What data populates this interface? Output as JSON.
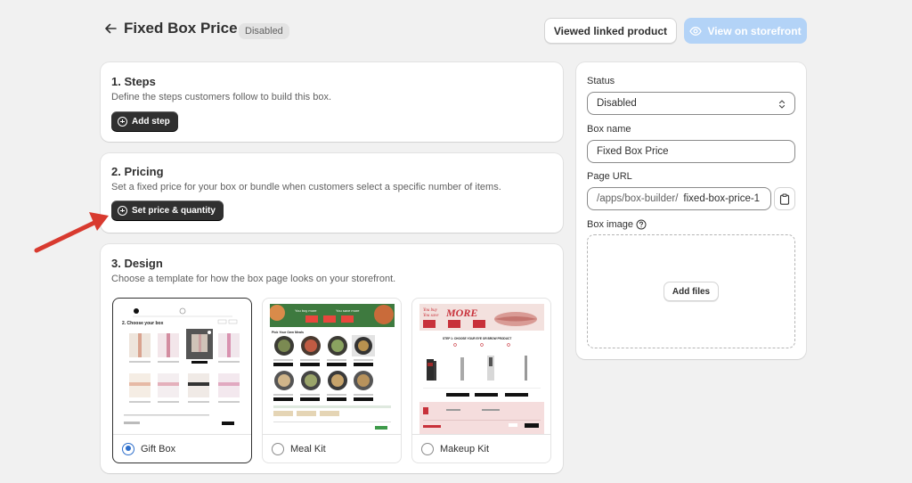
{
  "header": {
    "title": "Fixed Box Price",
    "status_badge": "Disabled",
    "linked_button": "Viewed linked product",
    "storefront_button": "View on storefront"
  },
  "steps": {
    "title": "1. Steps",
    "description": "Define the steps customers follow to build this box.",
    "button": "Add step"
  },
  "pricing": {
    "title": "2. Pricing",
    "description": "Set a fixed price for your box or bundle when customers select a specific number of items.",
    "button": "Set price & quantity"
  },
  "design": {
    "title": "3. Design",
    "description": "Choose a template for how the box page looks on your storefront.",
    "templates": [
      {
        "label": "Gift Box",
        "selected": true
      },
      {
        "label": "Meal Kit",
        "selected": false
      },
      {
        "label": "Makeup Kit",
        "selected": false
      }
    ],
    "thumbs": {
      "gift_heading": "2. Choose your box",
      "meal_banner_left": "You buy more",
      "meal_banner_right": "You save more",
      "meal_heading": "Pick Your Own Meals",
      "makeup_banner_small": "You buy",
      "makeup_banner_small2": "You save",
      "makeup_banner_big": "MORE",
      "makeup_heading": "STEP 1: CHOOSE YOUR EYE OR BROW PRODUCT"
    }
  },
  "sidebar": {
    "status_label": "Status",
    "status_value": "Disabled",
    "box_name_label": "Box name",
    "box_name_value": "Fixed Box Price",
    "page_url_label": "Page URL",
    "page_url_prefix": "/apps/box-builder/",
    "page_url_value": "fixed-box-price-1",
    "box_image_label": "Box image",
    "add_files": "Add files"
  },
  "colors": {
    "accent": "#2c6ecb",
    "primary_button": "#303030",
    "storefront_button": "#b3d3f7",
    "arrow": "#d83a2f"
  },
  "icons": [
    "arrow-left-icon",
    "eye-icon",
    "plus-circle-icon",
    "chevron-up-down-icon",
    "clipboard-icon",
    "help-circle-icon",
    "red-pointer-arrow"
  ]
}
